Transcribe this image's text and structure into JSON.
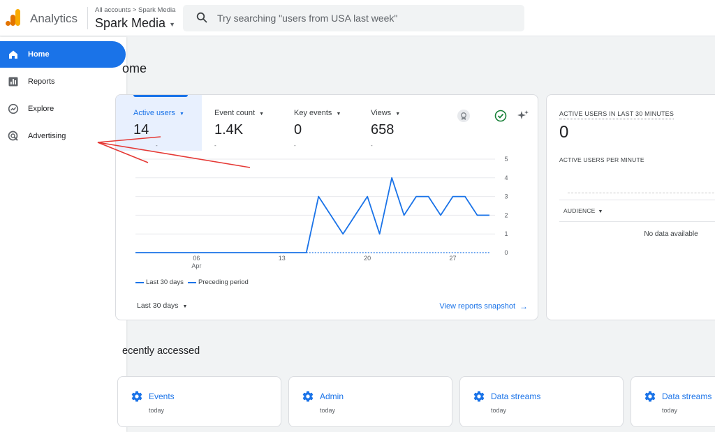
{
  "header": {
    "app_name": "Analytics",
    "breadcrumb": "All accounts > Spark Media",
    "account_name": "Spark Media",
    "search_placeholder": "Try searching \"users from USA last week\""
  },
  "sidebar": {
    "items": [
      {
        "label": "Home",
        "icon": "home-icon",
        "active": true
      },
      {
        "label": "Reports",
        "icon": "reports-icon",
        "active": false
      },
      {
        "label": "Explore",
        "icon": "explore-icon",
        "active": false
      },
      {
        "label": "Advertising",
        "icon": "advertising-icon",
        "active": false
      }
    ]
  },
  "main": {
    "title": "ome",
    "metrics": [
      {
        "label": "Active users",
        "value": "14",
        "tick": "-"
      },
      {
        "label": "Event count",
        "value": "1.4K",
        "tick": "-"
      },
      {
        "label": "Key events",
        "value": "0",
        "tick": "-"
      },
      {
        "label": "Views",
        "value": "658",
        "tick": "-"
      }
    ],
    "legend": {
      "current": "Last 30 days",
      "previous": "Preceding period"
    },
    "range_label": "Last 30 days",
    "snapshot_link": "View reports snapshot",
    "recent_title": "ecently accessed"
  },
  "chart_data": {
    "type": "line",
    "x_tick_labels": [
      {
        "day": 6,
        "label": "06",
        "sublabel": "Apr"
      },
      {
        "day": 13,
        "label": "13"
      },
      {
        "day": 20,
        "label": "20"
      },
      {
        "day": 27,
        "label": "27"
      }
    ],
    "y_ticks": [
      0,
      1,
      2,
      3,
      4,
      5
    ],
    "ylim": [
      0,
      5
    ],
    "xlim": [
      1,
      30
    ],
    "series": [
      {
        "name": "Last 30 days",
        "style": "solid",
        "x": [
          1,
          2,
          3,
          4,
          5,
          6,
          7,
          8,
          9,
          10,
          11,
          12,
          13,
          14,
          15,
          16,
          17,
          18,
          19,
          20,
          21,
          22,
          23,
          24,
          25,
          26,
          27,
          28,
          29,
          30
        ],
        "y": [
          0,
          0,
          0,
          0,
          0,
          0,
          0,
          0,
          0,
          0,
          0,
          0,
          0,
          0,
          0,
          3,
          2,
          1,
          2,
          3,
          1,
          4,
          2,
          3,
          3,
          2,
          3,
          3,
          2,
          2
        ]
      },
      {
        "name": "Preceding period",
        "style": "dashed",
        "x": [
          15,
          16,
          17,
          18,
          19,
          20,
          21,
          22,
          23,
          24,
          25,
          26,
          27,
          28,
          29,
          30
        ],
        "y": [
          0,
          0,
          0,
          0,
          0,
          0,
          0,
          0,
          0,
          0,
          0,
          0,
          0,
          0,
          0,
          0
        ]
      }
    ],
    "color": "#1a73e8",
    "grid": true
  },
  "realtime": {
    "title": "ACTIVE USERS IN LAST 30 MINUTES",
    "value": "0",
    "subtitle": "ACTIVE USERS PER MINUTE",
    "audience_label": "AUDIENCE",
    "no_data": "No data available"
  },
  "recent": [
    {
      "title": "Events",
      "sub": "today"
    },
    {
      "title": "Admin",
      "sub": "today"
    },
    {
      "title": "Data streams",
      "sub": "today"
    },
    {
      "title": "Data streams",
      "sub": "today"
    }
  ],
  "colors": {
    "accent": "#1a73e8",
    "annotation": "#e53935",
    "logo_orange": "#f9ab00",
    "logo_dark": "#e37400"
  }
}
